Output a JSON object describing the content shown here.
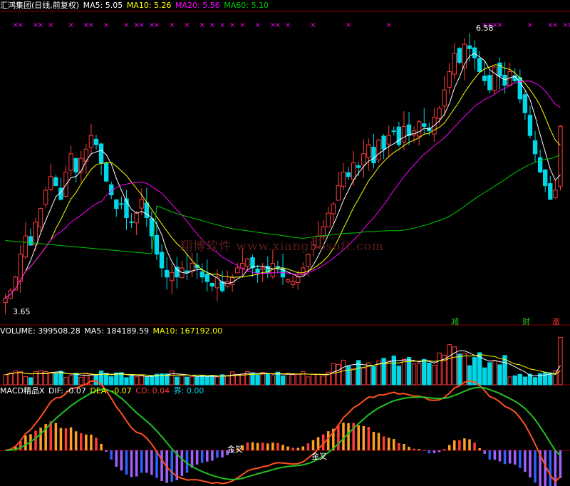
{
  "colors": {
    "up": "#ff3b3b",
    "down": "#00d8e8",
    "ma5": "#ffffff",
    "ma10": "#ffff00",
    "ma20": "#ff00ff",
    "ma60": "#00c800",
    "grid": "#8b0000",
    "marker": "#ff00ff",
    "signal": "#22c022"
  },
  "header": {
    "title": "汇鸿集团(日线,前复权)",
    "ma5": "MA5: 5.05",
    "ma10": "MA10: 5.26",
    "ma20": "MA20: 5.56",
    "ma60": "MA60: 5.10"
  },
  "volume_header": {
    "label": "VOLUME: 399508.28",
    "ma5": "MA5: 184189.59",
    "ma10": "MA10: 167192.00"
  },
  "macd_header": {
    "name": "MACD精品X",
    "dif": "DIF: -0.07",
    "dea": "DEA: -0.07",
    "cd": "CD: 0.04",
    "jie": "界: 0.00"
  },
  "annotations": {
    "high": "6.58",
    "low": "3.65",
    "sig_jian": "减",
    "sig_cai": "财",
    "sig_zhang": "涨",
    "gold_cross_1": "金叉",
    "gold_cross_2": "金叉"
  },
  "watermark": "翔博软件 www.xiangbosoft.com",
  "chart_data": [
    {
      "type": "candlestick",
      "title": "汇鸿集团(日线,前复权)",
      "series": [
        {
          "name": "MA5",
          "last": 5.05
        },
        {
          "name": "MA10",
          "last": 5.26
        },
        {
          "name": "MA20",
          "last": 5.56
        },
        {
          "name": "MA60",
          "last": 5.1
        }
      ],
      "price_high": 6.58,
      "price_low": 3.65,
      "ylim": [
        3.55,
        6.75
      ],
      "close": [
        3.72,
        3.8,
        3.95,
        4.2,
        4.4,
        4.3,
        4.55,
        4.7,
        4.9,
        5.05,
        4.95,
        4.8,
        5.1,
        5.3,
        5.1,
        5.25,
        5.35,
        5.5,
        5.4,
        5.2,
        5.0,
        4.85,
        4.7,
        4.75,
        4.6,
        4.55,
        4.65,
        4.8,
        4.6,
        4.4,
        4.2,
        4.05,
        3.95,
        4.0,
        3.95,
        4.05,
        4.0,
        4.1,
        4.05,
        3.95,
        3.9,
        3.85,
        3.95,
        3.8,
        3.9,
        3.95,
        4.05,
        4.1,
        4.15,
        4.05,
        4.0,
        4.05,
        4.0,
        4.1,
        4.05,
        3.95,
        3.92,
        3.9,
        3.95,
        4.05,
        4.2,
        4.3,
        4.4,
        4.5,
        4.65,
        4.75,
        4.95,
        5.1,
        5.05,
        5.2,
        5.15,
        5.3,
        5.4,
        5.2,
        5.45,
        5.35,
        5.5,
        5.55,
        5.4,
        5.6,
        5.5,
        5.55,
        5.65,
        5.6,
        5.55,
        5.7,
        5.8,
        6.0,
        6.2,
        6.4,
        6.3,
        6.5,
        6.45,
        6.35,
        6.2,
        6.1,
        6.0,
        6.25,
        6.15,
        6.05,
        6.2,
        6.1,
        5.9,
        5.75,
        5.5,
        5.3,
        5.1,
        4.95,
        4.8,
        4.9,
        5.6
      ],
      "volume": {
        "last": 399508.28,
        "ma5": 184189.59,
        "ma10": 167192.0
      }
    },
    {
      "type": "bar",
      "title": "MACD精品X",
      "series": [
        {
          "name": "DIF",
          "last": -0.07
        },
        {
          "name": "DEA",
          "last": -0.07
        },
        {
          "name": "CD",
          "last": 0.04
        },
        {
          "name": "界",
          "last": 0.0
        }
      ]
    }
  ]
}
